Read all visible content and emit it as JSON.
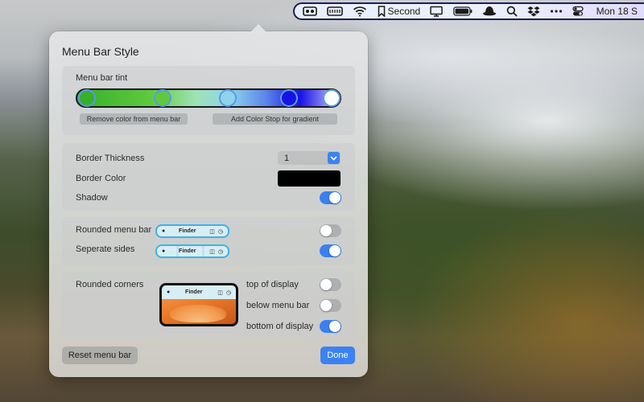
{
  "menubar": {
    "second_label": "Second",
    "clock": "Mon 18 S",
    "icons": [
      "bartender-icon",
      "keyboard-icon",
      "wifi-icon",
      "bookmark-icon",
      "display-icon",
      "battery-icon",
      "hat-icon",
      "search-icon",
      "dropbox-icon",
      "more-icon",
      "control-center-icon"
    ]
  },
  "popover": {
    "title": "Menu Bar Style",
    "tint": {
      "label": "Menu bar tint",
      "stops": [
        "#36b02a",
        "#5fc93e",
        "#8fd4ec",
        "#1712e4",
        "#ffffff"
      ],
      "remove_button": "Remove color from menu bar",
      "add_button": "Add Color Stop for gradient"
    },
    "border": {
      "thickness_label": "Border Thickness",
      "thickness_value": "1",
      "color_label": "Border Color",
      "color_value": "#000000",
      "shadow_label": "Shadow",
      "shadow_on": true
    },
    "shape": {
      "rounded_label": "Rounded menu bar",
      "rounded_on": false,
      "separate_label": "Seperate sides",
      "separate_on": true,
      "preview_text": "Finder"
    },
    "corners": {
      "label": "Rounded corners",
      "top_label": "top of display",
      "top_on": false,
      "below_label": "below menu bar",
      "below_on": false,
      "bottom_label": "bottom of display",
      "bottom_on": true,
      "preview_text": "Finder"
    },
    "reset_button": "Reset menu bar",
    "done_button": "Done"
  }
}
